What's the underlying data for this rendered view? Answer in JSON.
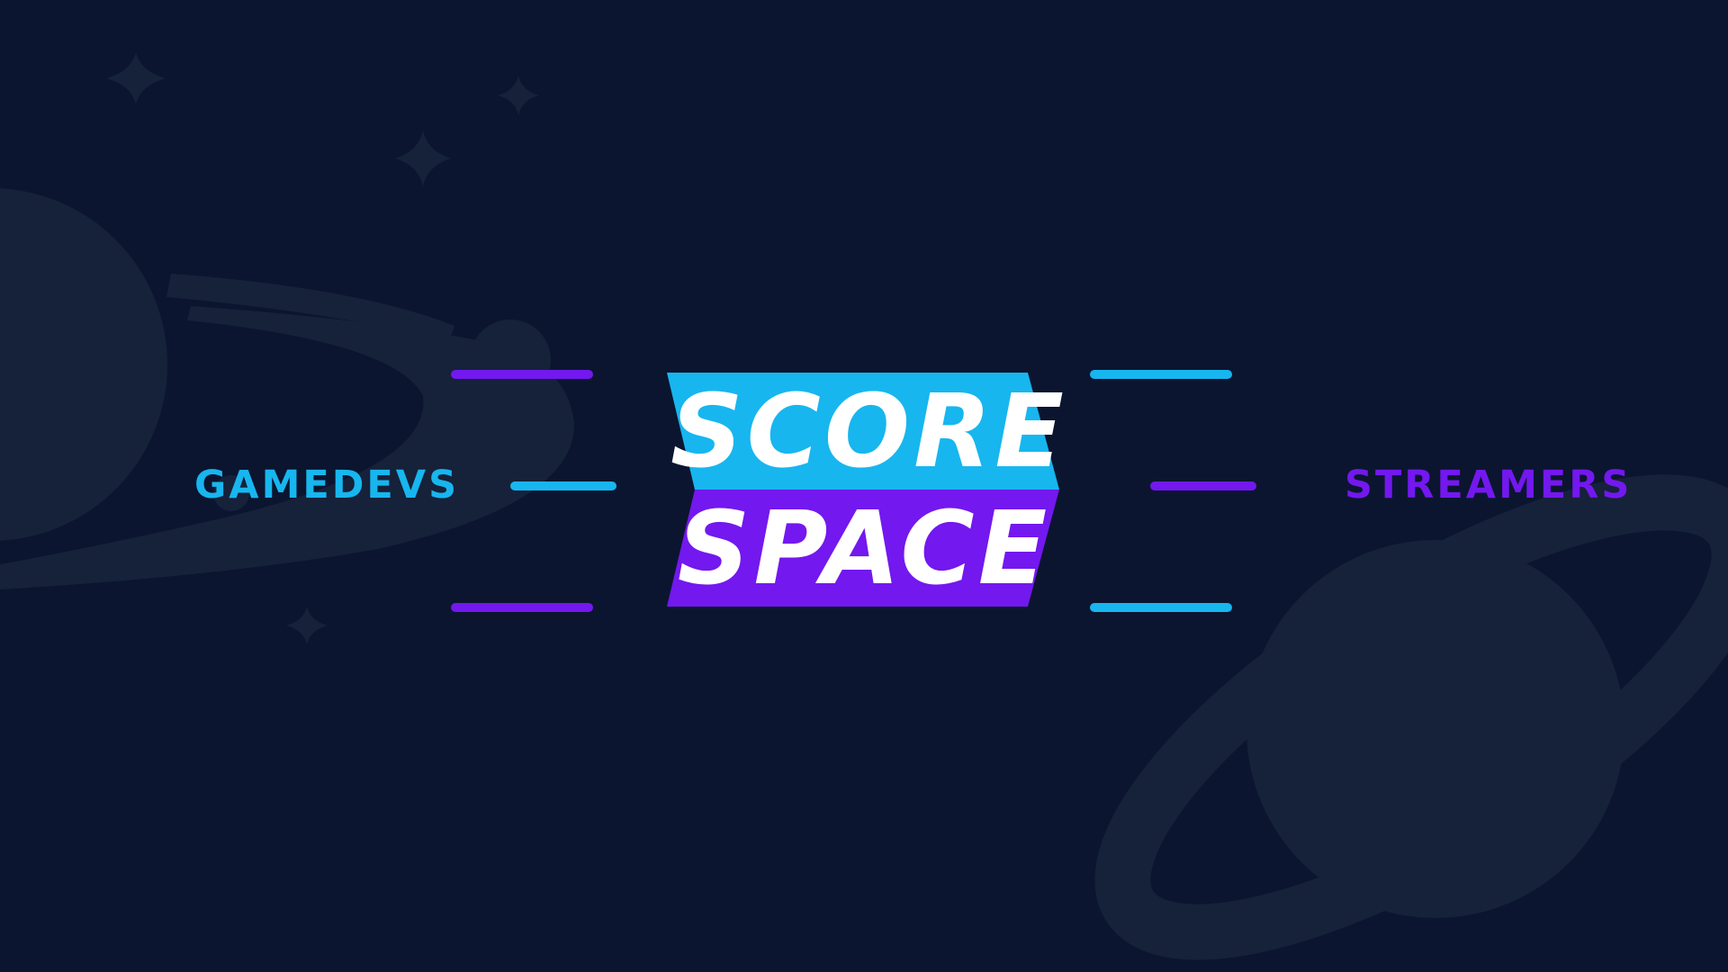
{
  "labels": {
    "left": "GAMEDEVS",
    "right": "STREAMERS"
  },
  "logo": {
    "top_word": "SCORE",
    "bottom_word": "SPACE"
  },
  "colors": {
    "background": "#0b1530",
    "decor": "#16213a",
    "cyan": "#17b6ef",
    "purple": "#7318ee",
    "white": "#ffffff"
  },
  "icons": [
    "planet-with-moon-icon",
    "ringed-planet-icon",
    "sparkle-star-icon"
  ]
}
